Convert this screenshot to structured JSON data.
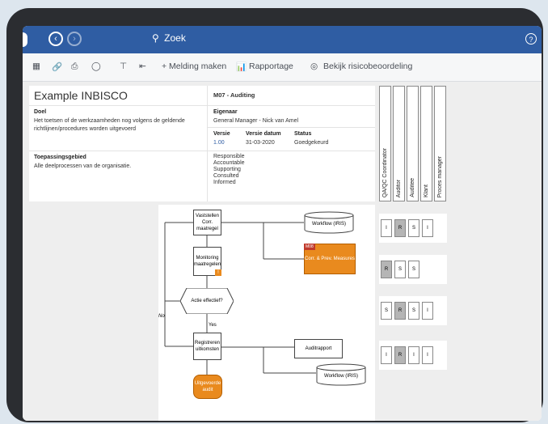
{
  "search": {
    "placeholder": "Zoek"
  },
  "toolbar": {
    "notify": "+ Melding maken",
    "report": "Rapportage",
    "risk": "Bekijk risicobeoordeling"
  },
  "process": {
    "title": "Example INBISCO",
    "code": "M07 - Auditing",
    "doel_label": "Doel",
    "doel_text": "Het toetsen of de werkzaamheden nog volgens de geldende richtlijnen/procedures worden uitgevoerd",
    "eigenaar_label": "Eigenaar",
    "eigenaar": "General Manager - Nick van Amel",
    "versie_label": "Versie",
    "versie": "1.00",
    "datum_label": "Versie datum",
    "datum": "31-03-2020",
    "status_label": "Status",
    "status": "Goedgekeurd",
    "scope_label": "Toepassingsgebied",
    "scope_text": "Alle deelprocessen van de organisatie.",
    "raci": [
      "Responsible",
      "Accountable",
      "Supporting",
      "Consulted",
      "Informed"
    ]
  },
  "roles": [
    "QA/QC Coordinator",
    "Auditor",
    "Auditee",
    "Klant",
    "Proces manager"
  ],
  "flow": {
    "vaststellen": "Vaststellen Corr. maatregel",
    "monitoring": "Monitoring maatregelen",
    "actie": "Actie effectief?",
    "no": "No",
    "yes": "Yes",
    "registreren": "Registreren uitkomsten",
    "uitgevoerde": "Uitgevoerde audit",
    "workflow1": "Workflow (IRIS)",
    "m08_tag": "M08",
    "m08": "Corr. & Prev. Measures",
    "auditrapport": "Auditrapport",
    "workflow2": "Workflow (IRIS)"
  },
  "raci_matrix": [
    [
      "I",
      "R",
      "S",
      "I",
      ""
    ],
    [
      "R",
      "S",
      "S",
      "",
      ""
    ],
    [
      "S",
      "R",
      "S",
      "I",
      ""
    ],
    [
      "I",
      "R",
      "I",
      "I",
      ""
    ]
  ]
}
